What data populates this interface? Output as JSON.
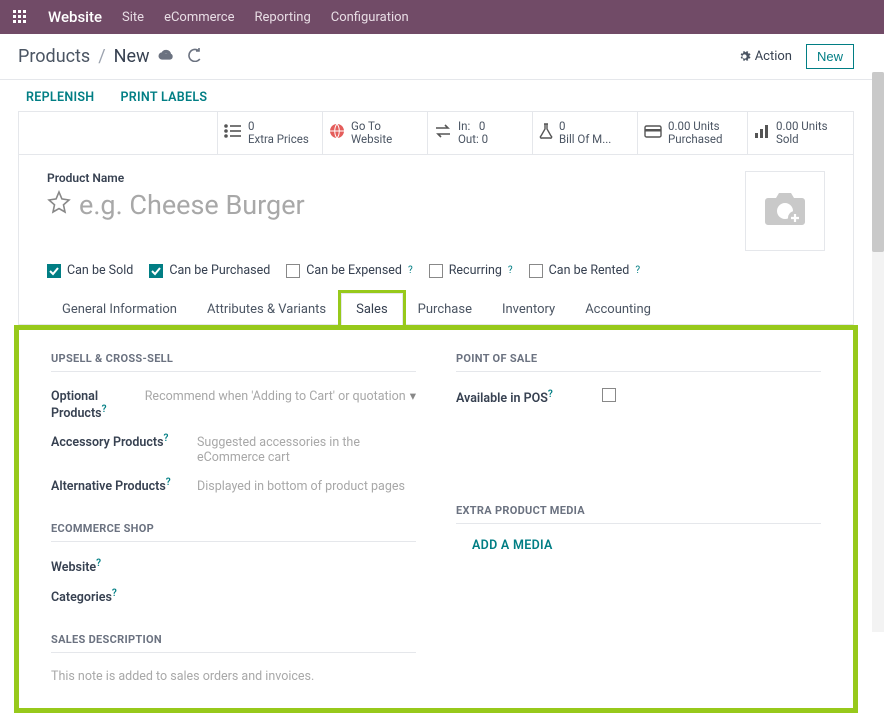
{
  "topbar": {
    "brand": "Website",
    "menu": [
      "Site",
      "eCommerce",
      "Reporting",
      "Configuration"
    ]
  },
  "header": {
    "breadcrumb_root": "Products",
    "breadcrumb_sep": "/",
    "breadcrumb_current": "New",
    "action_label": "Action",
    "new_label": "New"
  },
  "sub_actions": {
    "replenish": "REPLENISH",
    "print_labels": "PRINT LABELS"
  },
  "stats": {
    "extra_prices_num": "0",
    "extra_prices_label": "Extra Prices",
    "goto_l1": "Go To",
    "goto_l2": "Website",
    "in_label": "In:",
    "in_val": "0",
    "out_label": "Out:",
    "out_val": "0",
    "bom_num": "0",
    "bom_label": "Bill Of M...",
    "purchased_num": "0.00 Units",
    "purchased_label": "Purchased",
    "sold_num": "0.00 Units",
    "sold_label": "Sold"
  },
  "product": {
    "name_label": "Product Name",
    "name_placeholder": "e.g. Cheese Burger"
  },
  "checks": {
    "sold": "Can be Sold",
    "purchased": "Can be Purchased",
    "expensed": "Can be Expensed",
    "recurring": "Recurring",
    "rented": "Can be Rented"
  },
  "tabs": {
    "general": "General Information",
    "attrs": "Attributes & Variants",
    "sales": "Sales",
    "purchase": "Purchase",
    "inventory": "Inventory",
    "accounting": "Accounting"
  },
  "sales_tab": {
    "upsell_head": "UPSELL & CROSS-SELL",
    "optional_products": "Optional Products",
    "optional_placeholder": "Recommend when 'Adding to Cart' or quotation",
    "accessory_products": "Accessory Products",
    "accessory_placeholder": "Suggested accessories in the eCommerce cart",
    "alternative_products": "Alternative Products",
    "alternative_placeholder": "Displayed in bottom of product pages",
    "ecommerce_head": "ECOMMERCE SHOP",
    "website_label": "Website",
    "categories_label": "Categories",
    "sales_desc_head": "SALES DESCRIPTION",
    "sales_desc_placeholder": "This note is added to sales orders and invoices.",
    "pos_head": "POINT OF SALE",
    "pos_avail": "Available in POS",
    "media_head": "EXTRA PRODUCT MEDIA",
    "add_media": "ADD A MEDIA"
  }
}
